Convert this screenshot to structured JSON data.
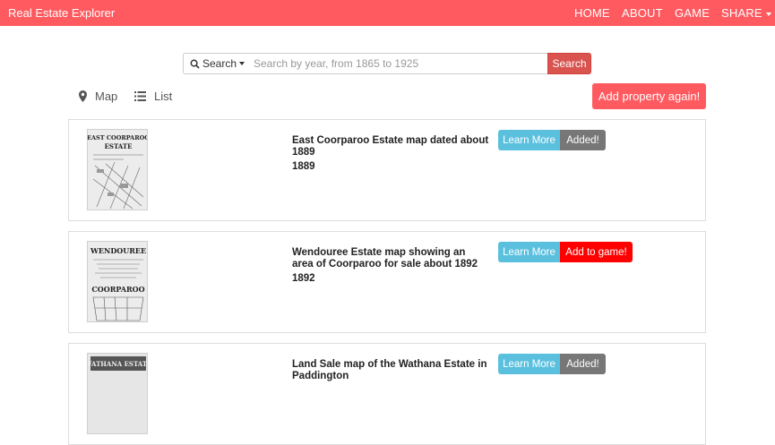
{
  "navbar": {
    "brand": "Real Estate Explorer",
    "links": [
      "HOME",
      "ABOUT",
      "GAME",
      "SHARE"
    ],
    "color": "#ff5a5f"
  },
  "search": {
    "dropdown_label": "Search",
    "placeholder": "Search by year, from 1865 to 1925",
    "value": "",
    "button_label": "Search"
  },
  "views": {
    "map_label": "Map",
    "list_label": "List"
  },
  "add_again_label": "Add property again!",
  "results": [
    {
      "title": "East Coorparoo Estate map dated about 1889",
      "year": "1889",
      "learn_label": "Learn More",
      "action_label": "Added!",
      "thumb_text": [
        "EAST COORPAROO",
        "ESTATE"
      ]
    },
    {
      "title": "Wendouree Estate map showing an area of Coorparoo for sale about 1892",
      "year": "1892",
      "learn_label": "Learn More",
      "action_label": "Add to game!",
      "thumb_text": [
        "WENDOUREE",
        "COORPAROO"
      ]
    },
    {
      "title": "Land Sale map of the Wathana Estate in Paddington",
      "year": "",
      "learn_label": "Learn More",
      "action_label": "Added!",
      "thumb_text": [
        "WATHANA ESTATE"
      ]
    }
  ]
}
